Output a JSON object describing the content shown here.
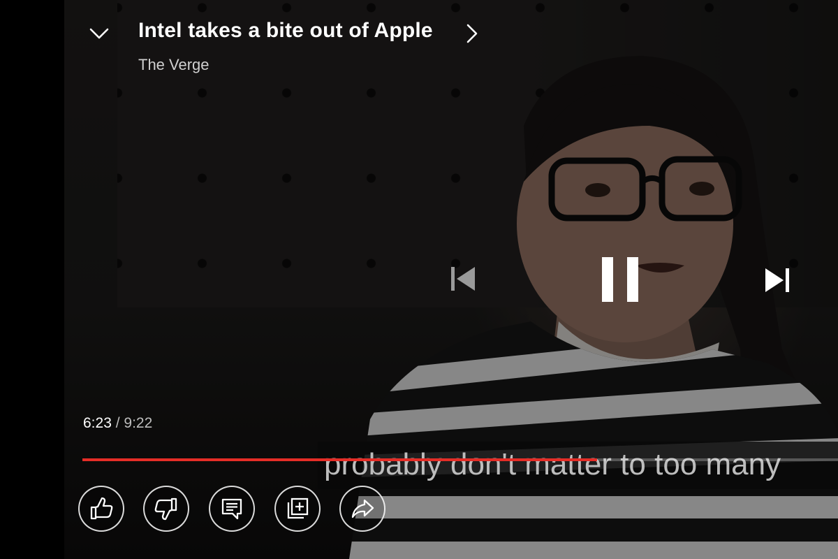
{
  "player": {
    "title": "Intel takes a bite out of Apple",
    "channel": "The Verge",
    "current_time": "6:23",
    "time_separator": " / ",
    "duration": "9:22",
    "progress": 0.681,
    "caption": "probably don't matter to too many"
  },
  "colors": {
    "progress_fill": "#e52d27",
    "text_primary": "#ffffff",
    "text_secondary": "#cfcfcf"
  },
  "icons": {
    "collapse": "chevron-down-icon",
    "title_more": "chevron-right-icon",
    "previous": "skip-previous-icon",
    "pause": "pause-icon",
    "next": "skip-next-icon",
    "like": "thumbs-up-icon",
    "dislike": "thumbs-down-icon",
    "comments": "comment-icon",
    "save": "add-to-playlist-icon",
    "share": "share-icon"
  }
}
